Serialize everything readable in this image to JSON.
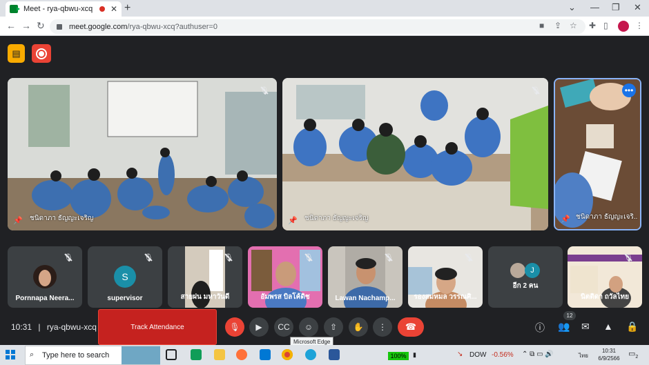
{
  "browser": {
    "tab_title": "Meet - rya-qbwu-xcq",
    "tab_close": "✕",
    "new_tab": "+",
    "url_host": "meet.google.com",
    "url_path": "/rya-qbwu-xcq?authuser=0",
    "window_controls": [
      "⌄",
      "—",
      "❐",
      "✕"
    ]
  },
  "meeting": {
    "main_tiles": [
      {
        "name": "ชนิดาภา ธัญญะเจริญ"
      },
      {
        "name": "ชนิดาภา ธัญญะเจริญ"
      },
      {
        "name": "ชนิดาภา ธัญญะเจริ..."
      }
    ],
    "participants": [
      {
        "name": "Pornnapa Neera...",
        "type": "photo"
      },
      {
        "name": "supervisor",
        "type": "initial",
        "initial": "S",
        "color": "#1a8fa8"
      },
      {
        "name": "สายฝน มหาวันดี",
        "type": "video"
      },
      {
        "name": "อัมพรส บิลโค้ดิช",
        "type": "video"
      },
      {
        "name": "Lawan Nachamp...",
        "type": "video"
      },
      {
        "name": "รองสมหมล วรรณศิ...",
        "type": "video"
      },
      {
        "name": "อีก 2 คน",
        "type": "group",
        "initial": "J",
        "color": "#1a8fa8"
      },
      {
        "name": "นิตติดา ถวัลไทย",
        "type": "video"
      }
    ],
    "time": "10:31",
    "separator": "|",
    "code": "rya-qbwu-xcq",
    "track_label": "Track Attendance",
    "tooltip": "Microsoft Edge",
    "people_count": "12"
  },
  "taskbar": {
    "search_placeholder": "Type here to search",
    "battery": "100%",
    "stock_name": "DOW",
    "stock_change": "-0.56%",
    "language": "ไทย",
    "clock_time": "10:31",
    "clock_date": "6/9/2566",
    "notifications": "2"
  },
  "colors": {
    "meet_bg": "#202124",
    "end_call": "#ea4335",
    "track_button": "#c5221f",
    "accent": "#8ab4f8"
  }
}
